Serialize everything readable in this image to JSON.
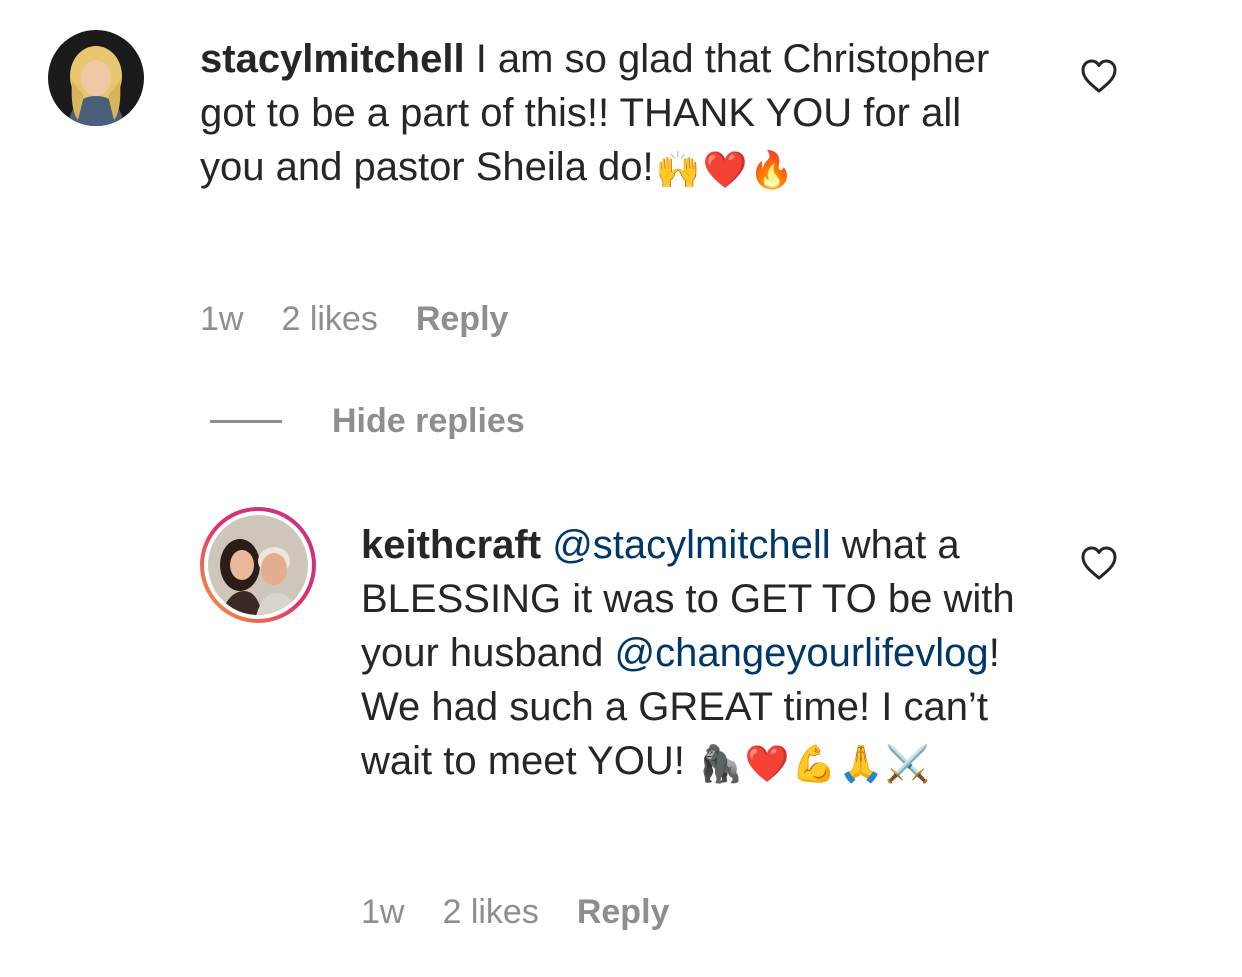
{
  "comments": [
    {
      "username": "stacylmitchell",
      "text_parts": [
        " I am so glad that Christopher got to be a part of this!! THANK YOU for all you and pastor Sheila do!"
      ],
      "emojis": [
        "🙌",
        "❤️",
        "🔥"
      ],
      "time": "1w",
      "likes": "2 likes",
      "reply_label": "Reply"
    }
  ],
  "hide_replies_label": "Hide replies",
  "reply": {
    "username": "keithcraft",
    "mention1": "@stacylmitchell",
    "text1": " what a BLESSING it was to GET TO be with your husband ",
    "mention2": "@changeyourlifevlog",
    "text2": "! We had such a GREAT time! I can’t wait to meet YOU! ",
    "emojis": [
      "🦍",
      "❤️",
      "💪",
      "🙏",
      "⚔️"
    ],
    "time": "1w",
    "likes": "2 likes",
    "reply_label": "Reply"
  },
  "icons": {
    "like": "heart-outline-icon"
  }
}
